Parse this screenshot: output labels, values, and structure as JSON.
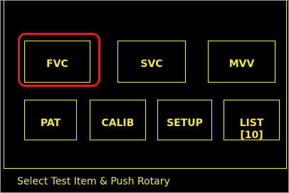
{
  "test_menu": {
    "row1": [
      {
        "label": "FVC",
        "selected": true
      },
      {
        "label": "SVC",
        "selected": false
      },
      {
        "label": "MVV",
        "selected": false
      }
    ],
    "row2": [
      {
        "label": "PAT"
      },
      {
        "label": "CALIB"
      },
      {
        "label": "SETUP"
      },
      {
        "label": "LIST\n[10]"
      }
    ]
  },
  "status_bar": {
    "message": "Select Test Item & Push Rotary"
  },
  "colors": {
    "background": "#000000",
    "foreground": "#f2e64a",
    "selection": "#e02020"
  }
}
